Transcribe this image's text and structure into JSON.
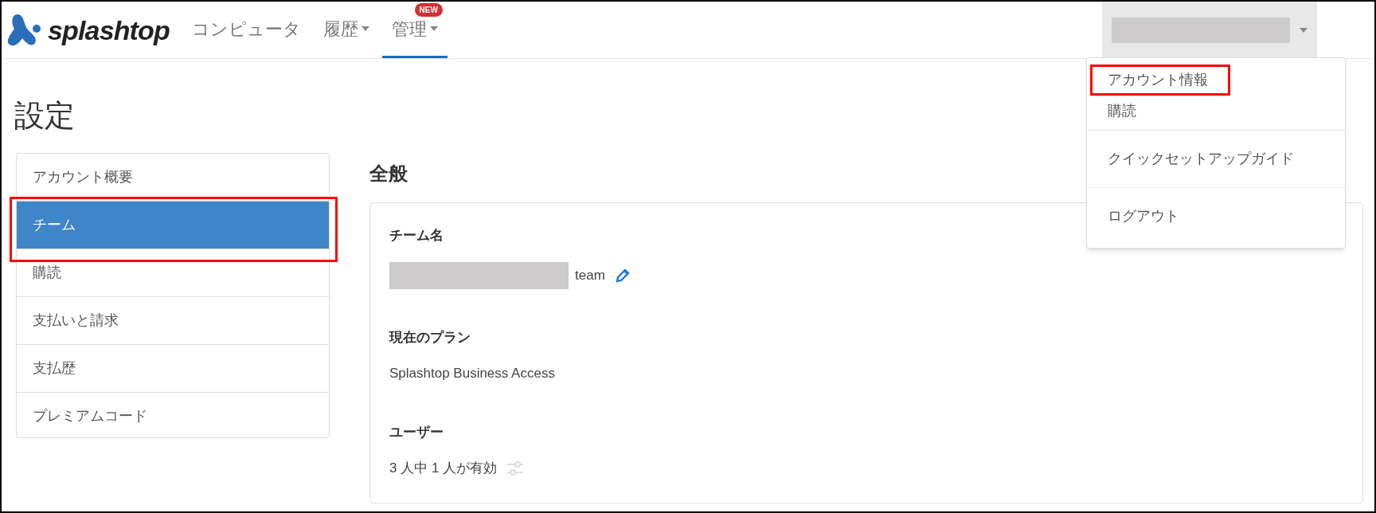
{
  "header": {
    "logo_text": "splashtop",
    "nav": [
      {
        "label": "コンピュータ",
        "selected": false,
        "dropdown": false
      },
      {
        "label": "履歴",
        "selected": false,
        "dropdown": true
      },
      {
        "label": "管理",
        "selected": true,
        "dropdown": true,
        "badge": "NEW"
      }
    ]
  },
  "account_menu": {
    "groups": [
      [
        {
          "label": "アカウント情報",
          "highlighted": true
        },
        {
          "label": "購読",
          "highlighted": false
        }
      ],
      [
        {
          "label": "クイックセットアップガイド",
          "highlighted": false
        }
      ],
      [
        {
          "label": "ログアウト",
          "highlighted": false
        }
      ]
    ]
  },
  "page_title": "設定",
  "sidebar": {
    "items": [
      {
        "label": "アカウント概要",
        "selected": false
      },
      {
        "label": "チーム",
        "selected": true
      },
      {
        "label": "購読",
        "selected": false
      },
      {
        "label": "支払いと請求",
        "selected": false
      },
      {
        "label": "支払歴",
        "selected": false
      },
      {
        "label": "プレミアムコード",
        "selected": false
      }
    ]
  },
  "section": {
    "title": "全般",
    "fields": [
      {
        "kind": "team",
        "label": "チーム名",
        "value": "team"
      },
      {
        "kind": "text",
        "label": "現在のプラン",
        "value": "Splashtop Business Access"
      },
      {
        "kind": "users",
        "label": "ユーザー",
        "value": "3 人中 1 人が有効"
      }
    ]
  }
}
